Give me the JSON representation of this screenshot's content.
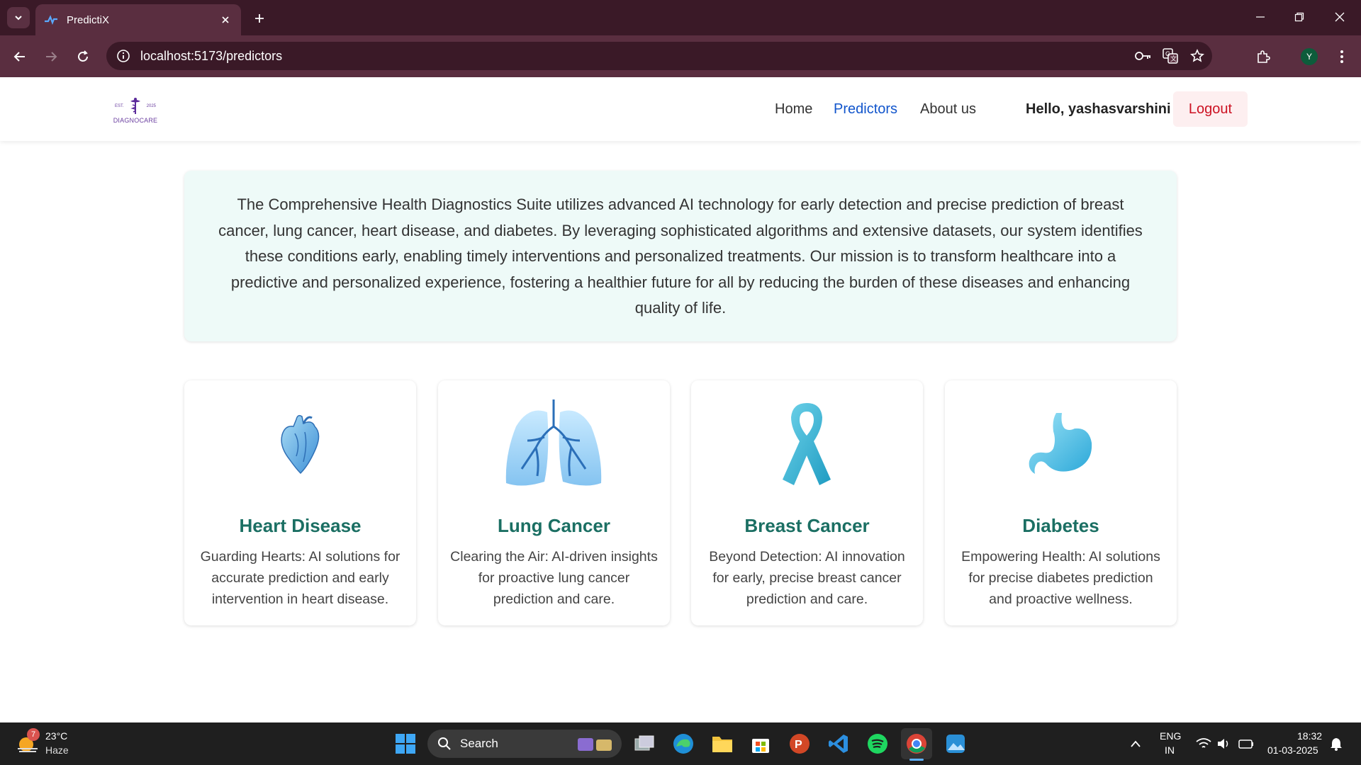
{
  "browser": {
    "tab_title": "PredictiX",
    "url": "localhost:5173/predictors",
    "profile_initial": "Y"
  },
  "logo": {
    "est": "EST.",
    "year": "2025",
    "name": "DIAGNOCARE"
  },
  "nav": {
    "home": "Home",
    "predictors": "Predictors",
    "about": "About us",
    "greeting": "Hello, yashasvarshini",
    "logout": "Logout"
  },
  "intro": "The Comprehensive Health Diagnostics Suite utilizes advanced AI technology for early detection and precise prediction of breast cancer, lung cancer, heart disease, and diabetes. By leveraging sophisticated algorithms and extensive datasets, our system identifies these conditions early, enabling timely interventions and personalized treatments. Our mission is to transform healthcare into a predictive and personalized experience, fostering a healthier future for all by reducing the burden of these diseases and enhancing quality of life.",
  "cards": [
    {
      "title": "Heart Disease",
      "desc": "Guarding Hearts: AI solutions for accurate prediction and early intervention in heart disease.",
      "icon": "heart-icon"
    },
    {
      "title": "Lung Cancer",
      "desc": "Clearing the Air: AI-driven insights for proactive lung cancer prediction and care.",
      "icon": "lungs-icon"
    },
    {
      "title": "Breast Cancer",
      "desc": "Beyond Detection: AI innovation for early, precise breast cancer prediction and care.",
      "icon": "ribbon-icon"
    },
    {
      "title": "Diabetes",
      "desc": "Empowering Health: AI solutions for precise diabetes prediction and proactive wellness.",
      "icon": "stomach-icon"
    }
  ],
  "taskbar": {
    "weather_temp": "23°C",
    "weather_cond": "Haze",
    "weather_badge": "7",
    "search": "Search",
    "lang1": "ENG",
    "lang2": "IN",
    "time": "18:32",
    "date": "01-03-2025"
  },
  "colors": {
    "accent": "#1155cc",
    "card_title": "#1b6f63",
    "logout": "#cc1122"
  }
}
